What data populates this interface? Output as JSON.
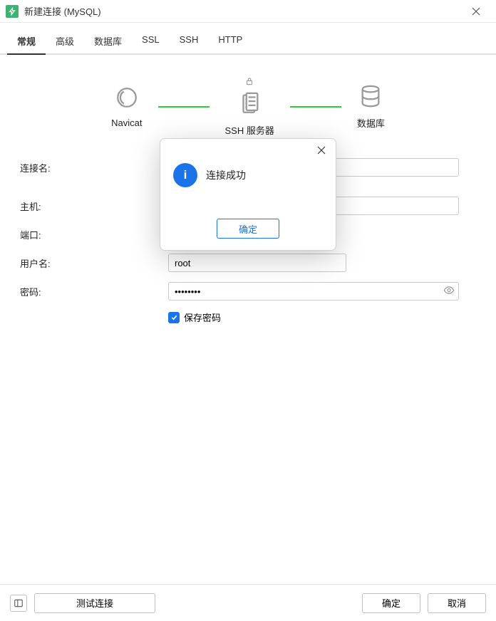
{
  "window": {
    "title": "新建连接 (MySQL)"
  },
  "tabs": {
    "general": "常规",
    "advanced": "高级",
    "database": "数据库",
    "ssl": "SSL",
    "ssh": "SSH",
    "http": "HTTP"
  },
  "diagram": {
    "navicat": "Navicat",
    "ssh": "SSH 服务器",
    "db": "数据库"
  },
  "form": {
    "conn_name_label": "连接名:",
    "conn_name_value": "",
    "host_label": "主机:",
    "host_value": "",
    "port_label": "端口:",
    "port_value": "",
    "user_label": "用户名:",
    "user_value": "root",
    "pw_label": "密码:",
    "pw_value": "••••••••",
    "save_pw_label": "保存密码"
  },
  "footer": {
    "test": "测试连接",
    "ok": "确定",
    "cancel": "取消"
  },
  "modal": {
    "message": "连接成功",
    "ok": "确定",
    "info_glyph": "i"
  }
}
